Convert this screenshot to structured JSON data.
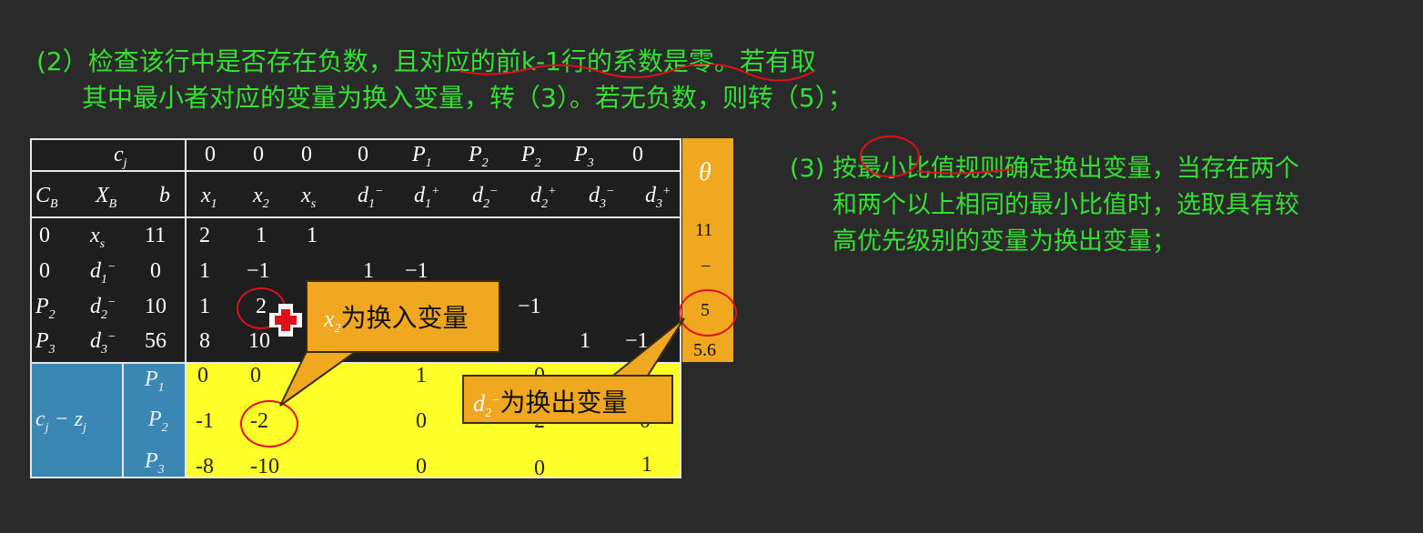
{
  "header": {
    "line1": "(2）检查该行中是否存在负数，且对应的前k-1行的系数是零。若有取",
    "line2": "其中最小者对应的变量为换入变量，转（3）。若无负数，则转（5）；"
  },
  "right_note": {
    "line1": "(3) 按最小比值规则确定换出变量，当存在两个",
    "line2": "和两个以上相同的最小比值时，选取具有较",
    "line3": "高优先级别的变量为换出变量；"
  },
  "table": {
    "cj_label": "c",
    "cj_sub": "j",
    "cj_values": [
      "0",
      "0",
      "0",
      "0",
      "P",
      "P",
      "P",
      "P",
      "0"
    ],
    "cj_subs": [
      "",
      "",
      "",
      "",
      "1",
      "2",
      "2",
      "3",
      ""
    ],
    "header_left": {
      "cb": "C",
      "cb_sub": "B",
      "xb": "X",
      "xb_sub": "B",
      "b": "b"
    },
    "vars": [
      {
        "name": "x",
        "sub": "1",
        "sup": ""
      },
      {
        "name": "x",
        "sub": "2",
        "sup": ""
      },
      {
        "name": "x",
        "sub": "s",
        "sup": ""
      },
      {
        "name": "d",
        "sub": "1",
        "sup": "−"
      },
      {
        "name": "d",
        "sub": "1",
        "sup": "+"
      },
      {
        "name": "d",
        "sub": "2",
        "sup": "−"
      },
      {
        "name": "d",
        "sub": "2",
        "sup": "+"
      },
      {
        "name": "d",
        "sub": "3",
        "sup": "−"
      },
      {
        "name": "d",
        "sub": "3",
        "sup": "+"
      }
    ],
    "theta_label": "θ",
    "rows": [
      {
        "cb": "0",
        "cb_sub": "",
        "xb": "x",
        "xb_sub": "s",
        "xb_sup": "",
        "b": "11",
        "v1": "2",
        "v2": "1",
        "v3": "1",
        "v4": "",
        "v5": "",
        "v6": "",
        "v7": "",
        "v8": "",
        "v9": "",
        "theta": "11"
      },
      {
        "cb": "0",
        "cb_sub": "",
        "xb": "d",
        "xb_sub": "1",
        "xb_sup": "−",
        "b": "0",
        "v1": "1",
        "v2": "−1",
        "v3": "",
        "v4": "1",
        "v5": "−1",
        "v6": "",
        "v7": "",
        "v8": "",
        "v9": "",
        "theta": "−"
      },
      {
        "cb": "P",
        "cb_sub": "2",
        "xb": "d",
        "xb_sub": "2",
        "xb_sup": "−",
        "b": "10",
        "v1": "1",
        "v2": "2",
        "v3": "",
        "v4": "",
        "v5": "",
        "v6": "",
        "v7": "−1",
        "v8": "",
        "v9": "",
        "theta": "5"
      },
      {
        "cb": "P",
        "cb_sub": "3",
        "xb": "d",
        "xb_sub": "3",
        "xb_sup": "−",
        "b": "56",
        "v1": "8",
        "v2": "10",
        "v3": "",
        "v4": "",
        "v5": "",
        "v6": "",
        "v7": "",
        "v8": "1",
        "v9": "−1",
        "theta": "5.6"
      }
    ],
    "cz_label": "c",
    "cz_sub1": "j",
    "cz_minus": " − z",
    "cz_sub2": "j",
    "cz_rows": [
      {
        "p": "P",
        "p_sub": "1",
        "v1": "0",
        "v2": "0",
        "v5": "1",
        "v7": "0",
        "v9": "0"
      },
      {
        "p": "P",
        "p_sub": "2",
        "v1": "-1",
        "v2": "-2",
        "v5": "0",
        "v7": "2",
        "v9": "0"
      },
      {
        "p": "P",
        "p_sub": "3",
        "v1": "-8",
        "v2": "-10",
        "v5": "0",
        "v7": "0",
        "v9": "1"
      }
    ]
  },
  "callouts": {
    "enter": {
      "var": "x",
      "sub": "2",
      "text": "为换入变量"
    },
    "leave": {
      "var": "d",
      "sub": "2",
      "sup": "−",
      "text": "为换出变量"
    }
  },
  "colors": {
    "background": "#2a2a2a",
    "green_text": "#33e033",
    "yellow_fill": "#ffff2a",
    "orange_fill": "#f0a821",
    "blue_fill": "#3a87b3",
    "red_marker": "#e0101a"
  }
}
